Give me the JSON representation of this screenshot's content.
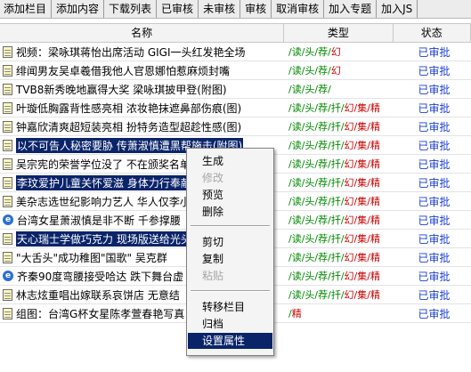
{
  "toolbar": [
    "添加栏目",
    "添加内容",
    "下载列表",
    "已审核",
    "未审核",
    "审核",
    "取消审核",
    "加入专题",
    "加入JS"
  ],
  "columns": {
    "name": "名称",
    "type": "类型",
    "status": "状态"
  },
  "rows": [
    {
      "title": "视频：梁咏琪蒋怡出席活动  GIGI一头红发艳全场",
      "type_green": "/读/头/荐/",
      "type_red": "幻",
      "status": "已审批",
      "icon": "doc"
    },
    {
      "title": "绯闻男友吴卓羲借我他人官恩娜怕惹麻烦封嘴",
      "type_green": "/读/头/荐/",
      "type_red": "幻",
      "status": "已审批",
      "icon": "doc"
    },
    {
      "title": "TVB8新秀晚地赢得大奖  梁咏琪披甲登(附图)",
      "type_green": "/读/头/荐/",
      "type_red": "",
      "status": "已审批",
      "icon": "doc"
    },
    {
      "title": "叶璇低胸露背性感亮相  浓妆艳抹遮鼻部伤痕(图)",
      "type_green": "/读/头/荐/扦/",
      "type_red": "幻/集/精",
      "status": "已审批",
      "icon": "doc"
    },
    {
      "title": "钟嘉欣清爽超短装亮相  扮特务造型超趁性感(图)",
      "type_green": "/读/头/荐/扦/",
      "type_red": "幻/集/精",
      "status": "已审批",
      "icon": "doc"
    },
    {
      "title": "以不可告人秘密要胁  传萧淑慎遭黑帮施击(附图)",
      "type_green": "/读/头/荐/扦/",
      "type_red": "幻/集/精",
      "status": "已审批",
      "icon": "doc",
      "selected": true
    },
    {
      "title": "吴宗宪的荣誉学位没了  不在颁奖名单",
      "type_green": "/读/头/荐/扦/",
      "type_red": "幻/集/精",
      "status": "已审批",
      "icon": "doc"
    },
    {
      "title": "李玟爱护儿童关怀爱滋  身体力行奉献",
      "type_green": "/读/头/荐/扦/",
      "type_red": "幻/集/精",
      "status": "已审批",
      "icon": "doc",
      "selected": true
    },
    {
      "title": "美杂志选世纪影响力艺人  华人仅李小龙",
      "type_green": "/读/头/荐/扦/",
      "type_red": "幻/集/精",
      "status": "已审批",
      "icon": "doc"
    },
    {
      "title": "台湾女星萧淑慎是非不断  千参撑腰",
      "type_green": "/读/头/荐/扦/",
      "type_red": "幻/集/精",
      "status": "已审批",
      "icon": "ie"
    },
    {
      "title": "天心瑞士学做巧克力  现场版送给光头",
      "type_green": "/读/头/荐/扦/",
      "type_red": "幻/集/精",
      "status": "已审批",
      "icon": "doc",
      "selected": true
    },
    {
      "title": "\"大舌头\"成功稚图\"国歌\"  吴克群",
      "type_green": "/读/头/荐/扦/",
      "type_red": "幻/集/精",
      "status": "已审批",
      "icon": "doc"
    },
    {
      "title": "齐秦90度弯腰接受哈达  跌下舞台虚",
      "type_green": "/读/头/荐/扦/",
      "type_red": "幻/集/精",
      "status": "已审批",
      "icon": "ie"
    },
    {
      "title": "林志炫重唱出嫁联系哀饼店  无意结",
      "type_green": "/读/头/荐/扦/",
      "type_red": "幻/集/精",
      "status": "已审批",
      "icon": "doc"
    },
    {
      "title": "组图：台湾G杯女星陈孝萱春艳写真",
      "type_green": "/",
      "type_red": "精",
      "status": "已审批",
      "icon": "doc"
    }
  ],
  "context_menu": [
    {
      "label": "生成",
      "enabled": true
    },
    {
      "label": "修改",
      "enabled": false
    },
    {
      "label": "预览",
      "enabled": true
    },
    {
      "label": "删除",
      "enabled": true
    },
    {
      "label": "剪切",
      "enabled": true
    },
    {
      "label": "复制",
      "enabled": true
    },
    {
      "label": "粘贴",
      "enabled": false
    },
    {
      "label": "转移栏目",
      "enabled": true
    },
    {
      "label": "归档",
      "enabled": true
    },
    {
      "label": "设置属性",
      "enabled": true,
      "highlighted": true
    }
  ]
}
